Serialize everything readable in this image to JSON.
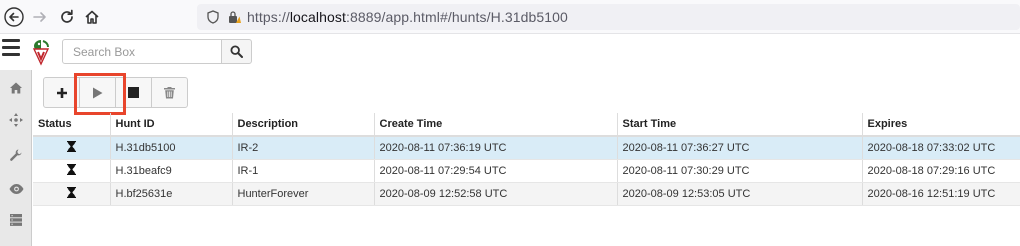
{
  "browser": {
    "url_prefix": "https://",
    "url_host": "localhost",
    "url_rest": ":8889/app.html#/hunts/H.31db5100"
  },
  "header": {
    "search_placeholder": "Search Box"
  },
  "sidebar": {
    "items": [
      {
        "icon": "home-icon"
      },
      {
        "icon": "crosshair-icon"
      },
      {
        "icon": "wrench-icon"
      },
      {
        "icon": "eye-icon"
      },
      {
        "icon": "server-icon"
      }
    ]
  },
  "toolbar": {
    "buttons": [
      {
        "icon": "plus-icon",
        "label": "New Hunt"
      },
      {
        "icon": "play-icon",
        "label": "Run Hunt"
      },
      {
        "icon": "stop-icon",
        "label": "Stop Hunt"
      },
      {
        "icon": "trash-icon",
        "label": "Delete Hunt"
      }
    ],
    "highlighted": "play-icon",
    "highlight_color": "#e8452c"
  },
  "table": {
    "columns": [
      "Status",
      "Hunt ID",
      "Description",
      "Create Time",
      "Start Time",
      "Expires"
    ],
    "rows": [
      {
        "status": "hourglass-icon",
        "hunt_id": "H.31db5100",
        "description": "IR-2",
        "create_time": "2020-08-11 07:36:19 UTC",
        "start_time": "2020-08-11 07:36:27 UTC",
        "expires": "2020-08-18 07:33:02 UTC",
        "selected": true
      },
      {
        "status": "hourglass-icon",
        "hunt_id": "H.31beafc9",
        "description": "IR-1",
        "create_time": "2020-08-11 07:29:54 UTC",
        "start_time": "2020-08-11 07:30:29 UTC",
        "expires": "2020-08-18 07:29:16 UTC",
        "selected": false
      },
      {
        "status": "hourglass-icon",
        "hunt_id": "H.bf25631e",
        "description": "HunterForever",
        "create_time": "2020-08-09 12:52:58 UTC",
        "start_time": "2020-08-09 12:53:05 UTC",
        "expires": "2020-08-16 12:51:19 UTC",
        "selected": false
      }
    ],
    "selected_row_color": "#d9ecf7"
  }
}
